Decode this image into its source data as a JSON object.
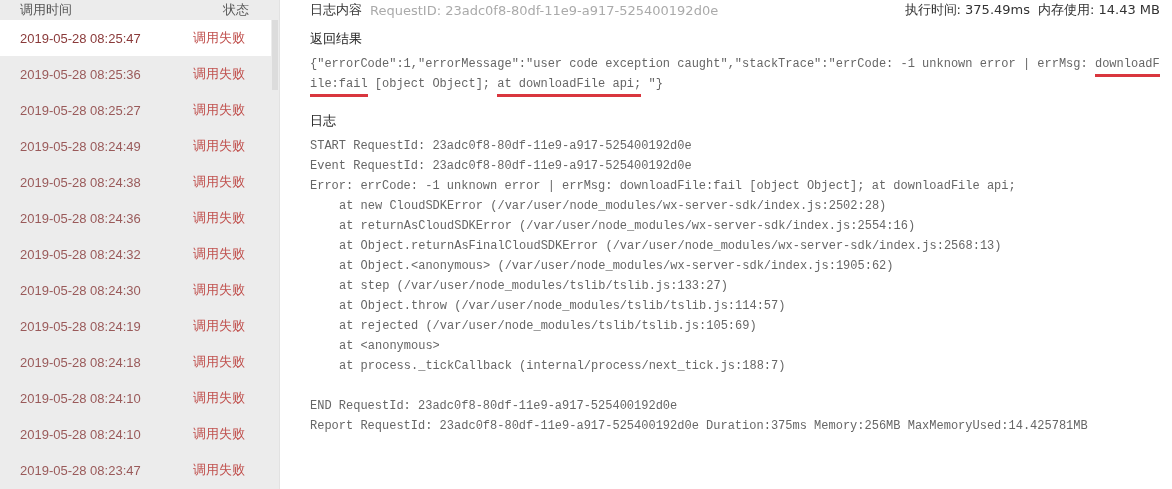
{
  "sidebar": {
    "columns": [
      "调用时间",
      "状态"
    ],
    "rows": [
      {
        "time": "2019-05-28 08:25:47",
        "status": "调用失败",
        "selected": true
      },
      {
        "time": "2019-05-28 08:25:36",
        "status": "调用失败",
        "selected": false
      },
      {
        "time": "2019-05-28 08:25:27",
        "status": "调用失败",
        "selected": false
      },
      {
        "time": "2019-05-28 08:24:49",
        "status": "调用失败",
        "selected": false
      },
      {
        "time": "2019-05-28 08:24:38",
        "status": "调用失败",
        "selected": false
      },
      {
        "time": "2019-05-28 08:24:36",
        "status": "调用失败",
        "selected": false
      },
      {
        "time": "2019-05-28 08:24:32",
        "status": "调用失败",
        "selected": false
      },
      {
        "time": "2019-05-28 08:24:30",
        "status": "调用失败",
        "selected": false
      },
      {
        "time": "2019-05-28 08:24:19",
        "status": "调用失败",
        "selected": false
      },
      {
        "time": "2019-05-28 08:24:18",
        "status": "调用失败",
        "selected": false
      },
      {
        "time": "2019-05-28 08:24:10",
        "status": "调用失败",
        "selected": false
      },
      {
        "time": "2019-05-28 08:24:10",
        "status": "调用失败",
        "selected": false
      },
      {
        "time": "2019-05-28 08:23:47",
        "status": "调用失败",
        "selected": false
      }
    ]
  },
  "detail": {
    "title": "日志内容",
    "request_id": "RequestID: 23adc0f8-80df-11e9-a917-525400192d0e",
    "exec_time": "执行时间: 375.49ms",
    "memory": "内存使用: 14.43 MB",
    "result": {
      "heading": "返回结果",
      "segments": [
        {
          "text": "{\"errorCode\":1,\"errorMessage\":\"user code exception caught\",\"stackTrace\":\"errCode: -1 unknown error | errMsg: ",
          "underlined": false
        },
        {
          "text": "downloadFile:fail",
          "underlined": true
        },
        {
          "text": " [object Object]; ",
          "underlined": false
        },
        {
          "text": "at downloadFile api;",
          "underlined": true
        },
        {
          "text": " \"}",
          "underlined": false
        }
      ]
    },
    "log": {
      "heading": "日志",
      "blocks": [
        {
          "lines": [
            {
              "text": "START RequestId: 23adc0f8-80df-11e9-a917-525400192d0e"
            },
            {
              "text": "Event RequestId: 23adc0f8-80df-11e9-a917-525400192d0e"
            },
            {
              "text": "Error: errCode: -1 unknown error | errMsg: downloadFile:fail [object Object]; at downloadFile api;",
              "children": [
                {
                  "text": "at new CloudSDKError (/var/user/node_modules/wx-server-sdk/index.js:2502:28)"
                },
                {
                  "text": "at returnAsCloudSDKError (/var/user/node_modules/wx-server-sdk/index.js:2554:16)"
                },
                {
                  "text": "at Object.returnAsFinalCloudSDKError (/var/user/node_modules/wx-server-sdk/index.js:2568:13)"
                },
                {
                  "text": "at Object.<anonymous> (/var/user/node_modules/wx-server-sdk/index.js:1905:62)"
                },
                {
                  "text": "at step (/var/user/node_modules/tslib/tslib.js:133:27)"
                },
                {
                  "text": "at Object.throw (/var/user/node_modules/tslib/tslib.js:114:57)"
                },
                {
                  "text": "at rejected (/var/user/node_modules/tslib/tslib.js:105:69)"
                },
                {
                  "text": "at <anonymous>"
                },
                {
                  "text": "at process._tickCallback (internal/process/next_tick.js:188:7)"
                }
              ]
            }
          ]
        },
        {
          "lines": [
            {
              "text": "END RequestId: 23adc0f8-80df-11e9-a917-525400192d0e"
            },
            {
              "text": "Report RequestId: 23adc0f8-80df-11e9-a917-525400192d0e Duration:375ms Memory:256MB MaxMemoryUsed:14.425781MB"
            }
          ]
        }
      ]
    }
  }
}
